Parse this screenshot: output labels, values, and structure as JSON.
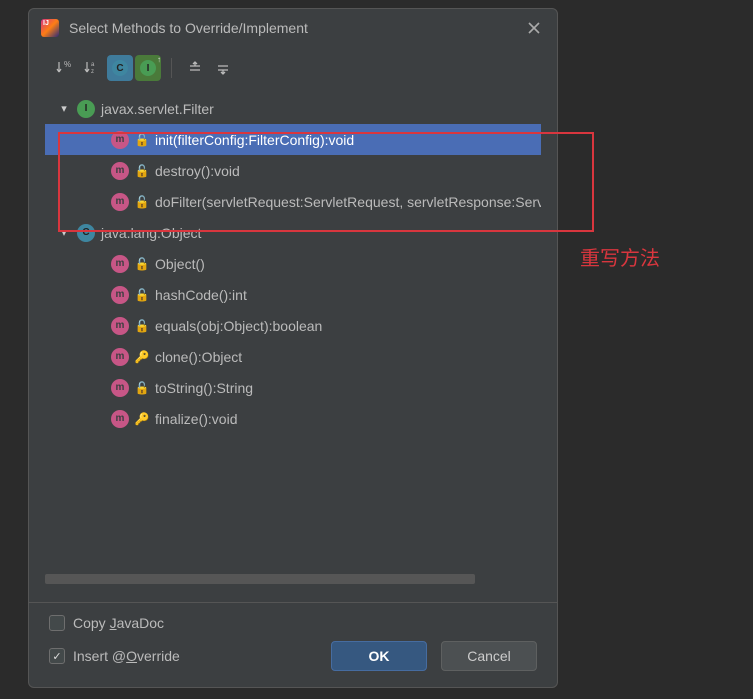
{
  "title": "Select Methods to Override/Implement",
  "toolbar": {
    "sort_alpha": "↓%",
    "sort_visibility": "↓ª",
    "show_classes": "C",
    "show_interfaces": "I¹",
    "expand_all": "⇱",
    "collapse_all": "⇲"
  },
  "tree": [
    {
      "kind": "I",
      "label": "javax.servlet.Filter",
      "expanded": true,
      "children": [
        {
          "kind": "m",
          "vis": "unlock",
          "sig": "init(filterConfig:FilterConfig):void",
          "selected": true
        },
        {
          "kind": "m",
          "vis": "unlock",
          "sig": "destroy():void"
        },
        {
          "kind": "m",
          "vis": "unlock",
          "sig": "doFilter(servletRequest:ServletRequest, servletResponse:ServletResponse, filterChain:FilterChain):void"
        }
      ]
    },
    {
      "kind": "C",
      "label": "java.lang.Object",
      "expanded": true,
      "children": [
        {
          "kind": "m",
          "vis": "unlock",
          "sig": "Object()"
        },
        {
          "kind": "m",
          "vis": "unlock",
          "sig": "hashCode():int"
        },
        {
          "kind": "m",
          "vis": "unlock",
          "sig": "equals(obj:Object):boolean"
        },
        {
          "kind": "m",
          "vis": "lock",
          "sig": "clone():Object"
        },
        {
          "kind": "m",
          "vis": "unlock",
          "sig": "toString():String"
        },
        {
          "kind": "m",
          "vis": "lock",
          "sig": "finalize():void"
        }
      ]
    }
  ],
  "checkboxes": {
    "copy_javadoc": {
      "label_pre": "Copy ",
      "mnemonic": "J",
      "label_post": "avaDoc",
      "checked": false
    },
    "insert_override": {
      "label_pre": "Insert @",
      "mnemonic": "O",
      "label_post": "verride",
      "checked": true
    }
  },
  "buttons": {
    "ok": "OK",
    "cancel": "Cancel"
  },
  "annotation": "重写方法"
}
